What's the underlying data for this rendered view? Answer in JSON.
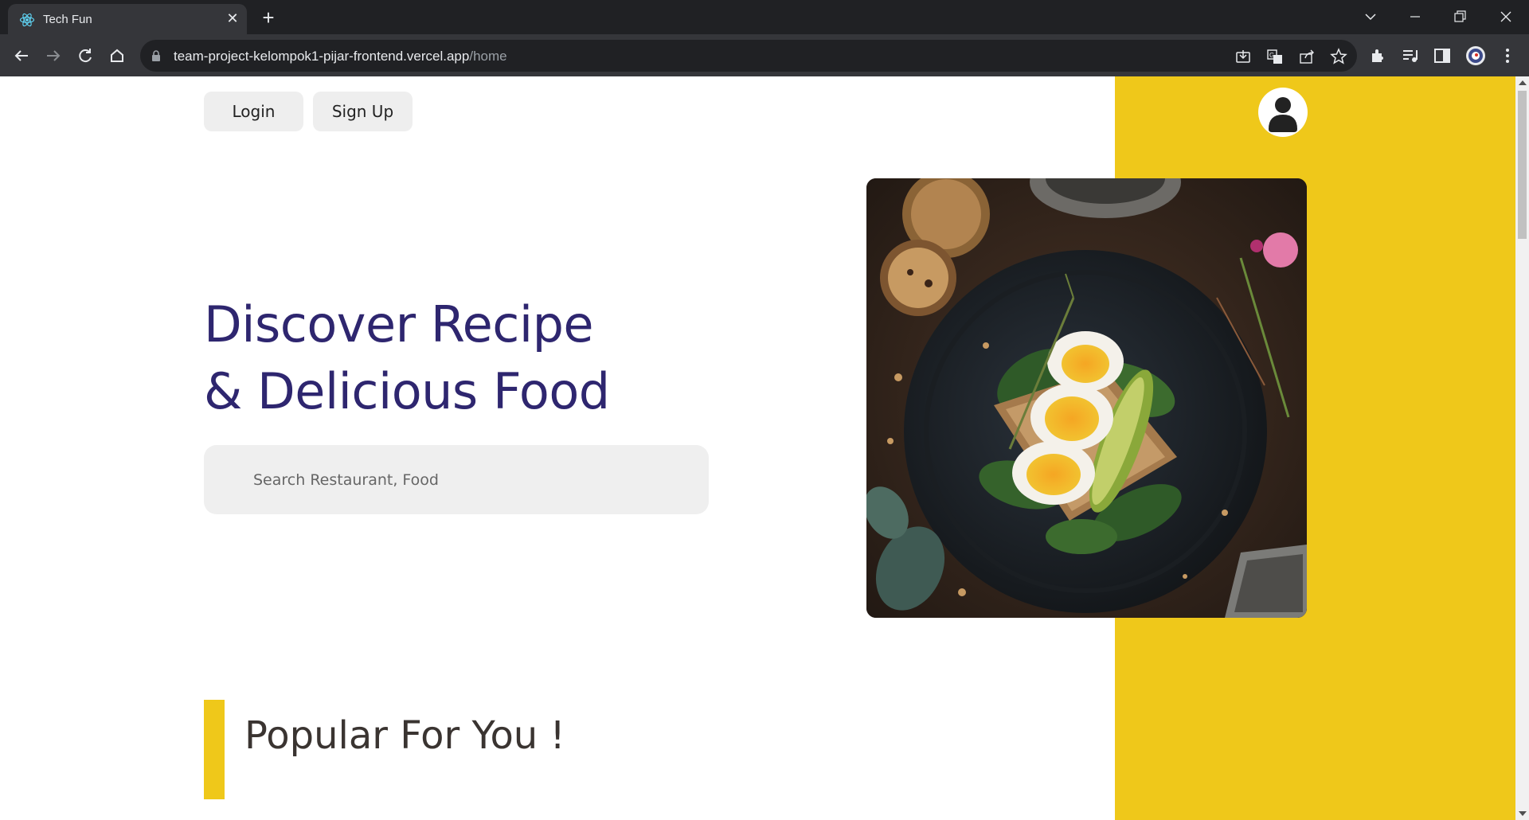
{
  "browser": {
    "tab_title": "Tech Fun",
    "url_host": "team-project-kelompok1-pijar-frontend.vercel.app",
    "url_path": "/home"
  },
  "header": {
    "login_label": "Login",
    "signup_label": "Sign Up"
  },
  "hero": {
    "title_line1": "Discover Recipe",
    "title_line2": "& Delicious Food",
    "search_placeholder": "Search Restaurant, Food",
    "image_alt": "Plate with boiled eggs, avocado and spinach toast"
  },
  "popular": {
    "title": "Popular For You !"
  },
  "colors": {
    "accent_yellow": "#efc81a",
    "title_navy": "#2e266f",
    "chrome_dark": "#202124",
    "chrome_toolbar": "#35363a"
  },
  "icons": [
    "react-favicon-icon",
    "close-icon",
    "plus-icon",
    "chevron-down-icon",
    "minimize-icon",
    "restore-icon",
    "back-icon",
    "forward-icon",
    "reload-icon",
    "home-icon",
    "lock-icon",
    "install-icon",
    "translate-icon",
    "share-icon",
    "star-icon",
    "extensions-icon",
    "media-icon",
    "side-panel-icon",
    "profile-icon",
    "menu-icon",
    "user-avatar-icon"
  ]
}
